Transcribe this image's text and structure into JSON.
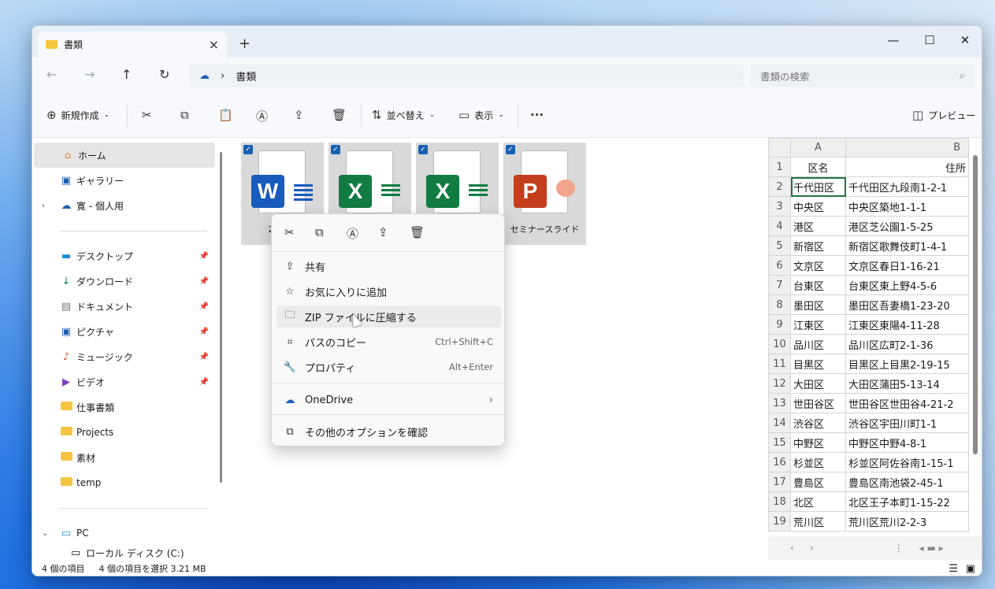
{
  "window": {
    "tab_title": "書類",
    "new_tab": "+",
    "minimize": "—",
    "maximize": "☐",
    "close": "✕"
  },
  "address": {
    "breadcrumb": "書類",
    "search_placeholder": "書類の検索"
  },
  "toolbar": {
    "new": "新規作成",
    "sort": "並べ替え",
    "view": "表示",
    "more": "···",
    "preview": "プレビュー"
  },
  "sidebar": {
    "home": "ホーム",
    "gallery": "ギャラリー",
    "onedrive": "寛 - 個人用",
    "desktop": "デスクトップ",
    "downloads": "ダウンロード",
    "documents": "ドキュメント",
    "pictures": "ピクチャ",
    "music": "ミュージック",
    "videos": "ビデオ",
    "work_docs": "仕事書類",
    "projects": "Projects",
    "materials": "素材",
    "temp": "temp",
    "pc": "PC",
    "local_disk": "ローカル ディスク (C:)"
  },
  "files": [
    {
      "name": "23区ク",
      "type": "W"
    },
    {
      "name": "",
      "type": "X"
    },
    {
      "name": "",
      "type": "X"
    },
    {
      "name": "セミナースライド",
      "type": "P"
    }
  ],
  "context_menu": {
    "share": "共有",
    "favorite": "お気に入りに追加",
    "zip": "ZIP ファイルに圧縮する",
    "copy_path": "パスのコピー",
    "copy_path_sc": "Ctrl+Shift+C",
    "properties": "プロパティ",
    "properties_sc": "Alt+Enter",
    "onedrive": "OneDrive",
    "more_options": "その他のオプションを確認"
  },
  "preview_sheet": {
    "col_a": "A",
    "col_b": "B",
    "rows": [
      [
        "1",
        "区名",
        "住所"
      ],
      [
        "2",
        "千代田区",
        "千代田区九段南1-2-1"
      ],
      [
        "3",
        "中央区",
        "中央区築地1-1-1"
      ],
      [
        "4",
        "港区",
        "港区芝公園1-5-25"
      ],
      [
        "5",
        "新宿区",
        "新宿区歌舞伎町1-4-1"
      ],
      [
        "6",
        "文京区",
        "文京区春日1-16-21"
      ],
      [
        "7",
        "台東区",
        "台東区東上野4-5-6"
      ],
      [
        "8",
        "墨田区",
        "墨田区吾妻橋1-23-20"
      ],
      [
        "9",
        "江東区",
        "江東区東陽4-11-28"
      ],
      [
        "10",
        "品川区",
        "品川区広町2-1-36"
      ],
      [
        "11",
        "目黒区",
        "目黒区上目黒2-19-15"
      ],
      [
        "12",
        "大田区",
        "大田区蒲田5-13-14"
      ],
      [
        "13",
        "世田谷区",
        "世田谷区世田谷4-21-2"
      ],
      [
        "14",
        "渋谷区",
        "渋谷区宇田川町1-1"
      ],
      [
        "15",
        "中野区",
        "中野区中野4-8-1"
      ],
      [
        "16",
        "杉並区",
        "杉並区阿佐谷南1-15-1"
      ],
      [
        "17",
        "豊島区",
        "豊島区南池袋2-45-1"
      ],
      [
        "18",
        "北区",
        "北区王子本町1-15-22"
      ],
      [
        "19",
        "荒川区",
        "荒川区荒川2-2-3"
      ]
    ]
  },
  "status": {
    "count": "4 個の項目",
    "selected": "4 個の項目を選択  3.21 MB"
  }
}
